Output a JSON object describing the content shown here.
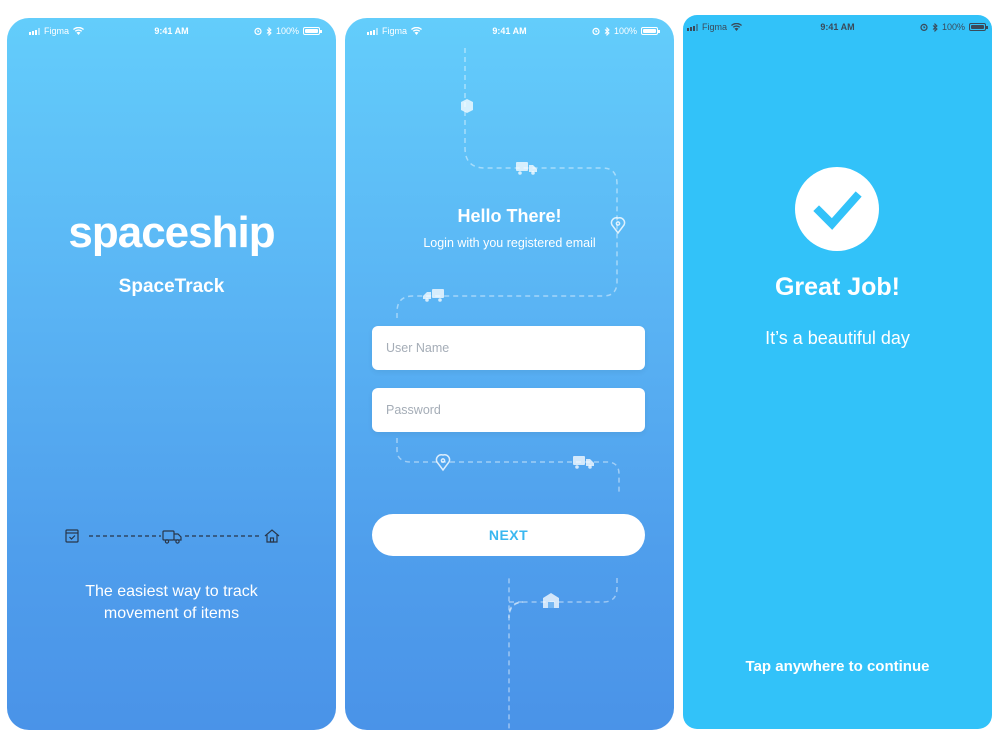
{
  "status_bar": {
    "carrier": "Figma",
    "time": "9:41 AM",
    "battery": "100%",
    "icons": [
      "signal-icon",
      "wifi-icon",
      "alarm-icon",
      "bluetooth-icon",
      "battery-icon"
    ]
  },
  "screen_splash": {
    "logo": "spaceship",
    "app_name": "SpaceTrack",
    "tagline_line1": "The easiest way to track",
    "tagline_line2": "movement of items",
    "track_icons": [
      "package-icon",
      "truck-icon",
      "home-icon"
    ]
  },
  "screen_login": {
    "title": "Hello There!",
    "subtitle": "Login with you registered email",
    "username_placeholder": "User Name",
    "password_placeholder": "Password",
    "next_label": "NEXT",
    "route_icons": [
      "box-icon",
      "truck-icon",
      "location-pin-icon",
      "truck-icon",
      "location-pin-icon",
      "truck-icon",
      "warehouse-icon"
    ]
  },
  "screen_success": {
    "title": "Great Job!",
    "subtitle": "It’s a beautiful day",
    "cta": "Tap anywhere to continue",
    "icon": "checkmark-icon"
  },
  "colors": {
    "gradient_top": "#63cdfb",
    "gradient_bottom": "#4a93e8",
    "success_bg": "#32c2f9",
    "accent": "#3ab7f0"
  }
}
